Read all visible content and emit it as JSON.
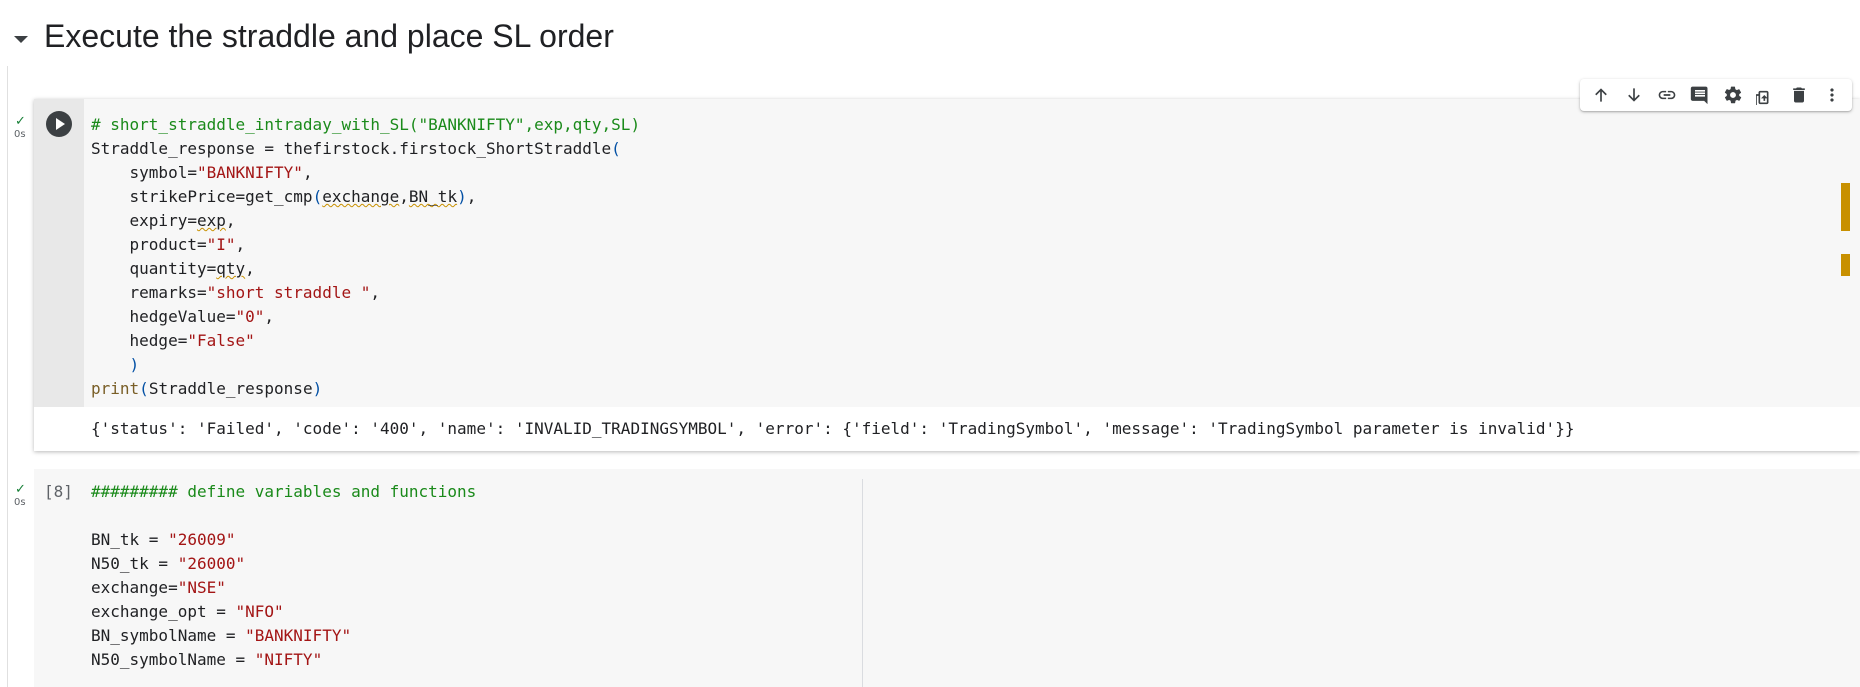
{
  "section": {
    "title": "Execute the straddle and place SL order"
  },
  "toolbar": {
    "buttons": [
      {
        "name": "move-cell-up",
        "icon": "arrow-up-icon"
      },
      {
        "name": "move-cell-down",
        "icon": "arrow-down-icon"
      },
      {
        "name": "copy-link",
        "icon": "link-icon"
      },
      {
        "name": "add-comment",
        "icon": "comment-icon"
      },
      {
        "name": "open-settings",
        "icon": "gear-icon"
      },
      {
        "name": "mirror-cell",
        "icon": "mirror-cell-icon"
      },
      {
        "name": "delete-cell",
        "icon": "trash-icon"
      },
      {
        "name": "more-actions",
        "icon": "more-vert-icon"
      }
    ]
  },
  "cell1": {
    "status_check": "✓",
    "exec_time": "0s",
    "lines": [
      "# short_straddle_intraday_with_SL(\"BANKNIFTY\",exp,qty,SL)",
      "Straddle_response = thefirstock.firstock_ShortStraddle(",
      "    symbol=\"BANKNIFTY\",",
      "    strikePrice=get_cmp(exchange,BN_tk),",
      "    expiry=exp,",
      "    product=\"I\",",
      "    quantity=qty,",
      "    remarks=\"short straddle \",",
      "    hedgeValue=\"0\",",
      "    hedge=\"False\"",
      "    )",
      "print(Straddle_response)"
    ],
    "output": "{'status': 'Failed', 'code': '400', 'name': 'INVALID_TRADINGSYMBOL', 'error': {'field': 'TradingSymbol', 'message': 'TradingSymbol parameter is invalid'}}"
  },
  "cell2": {
    "status_check": "✓",
    "exec_time": "0s",
    "exec_count": "[8]",
    "lines": [
      "######### define variables and functions",
      "",
      "BN_tk = \"26009\"",
      "N50_tk = \"26000\"",
      "exchange=\"NSE\"",
      "exchange_opt = \"NFO\"",
      "BN_symbolName = \"BANKNIFTY\"",
      "N50_symbolName = \"NIFTY\""
    ]
  },
  "colors": {
    "comment": "#1a8a1a",
    "string": "#a31515",
    "function": "#795e26",
    "paren": "#0451a5",
    "warning": "#c89000",
    "success": "#188038"
  }
}
